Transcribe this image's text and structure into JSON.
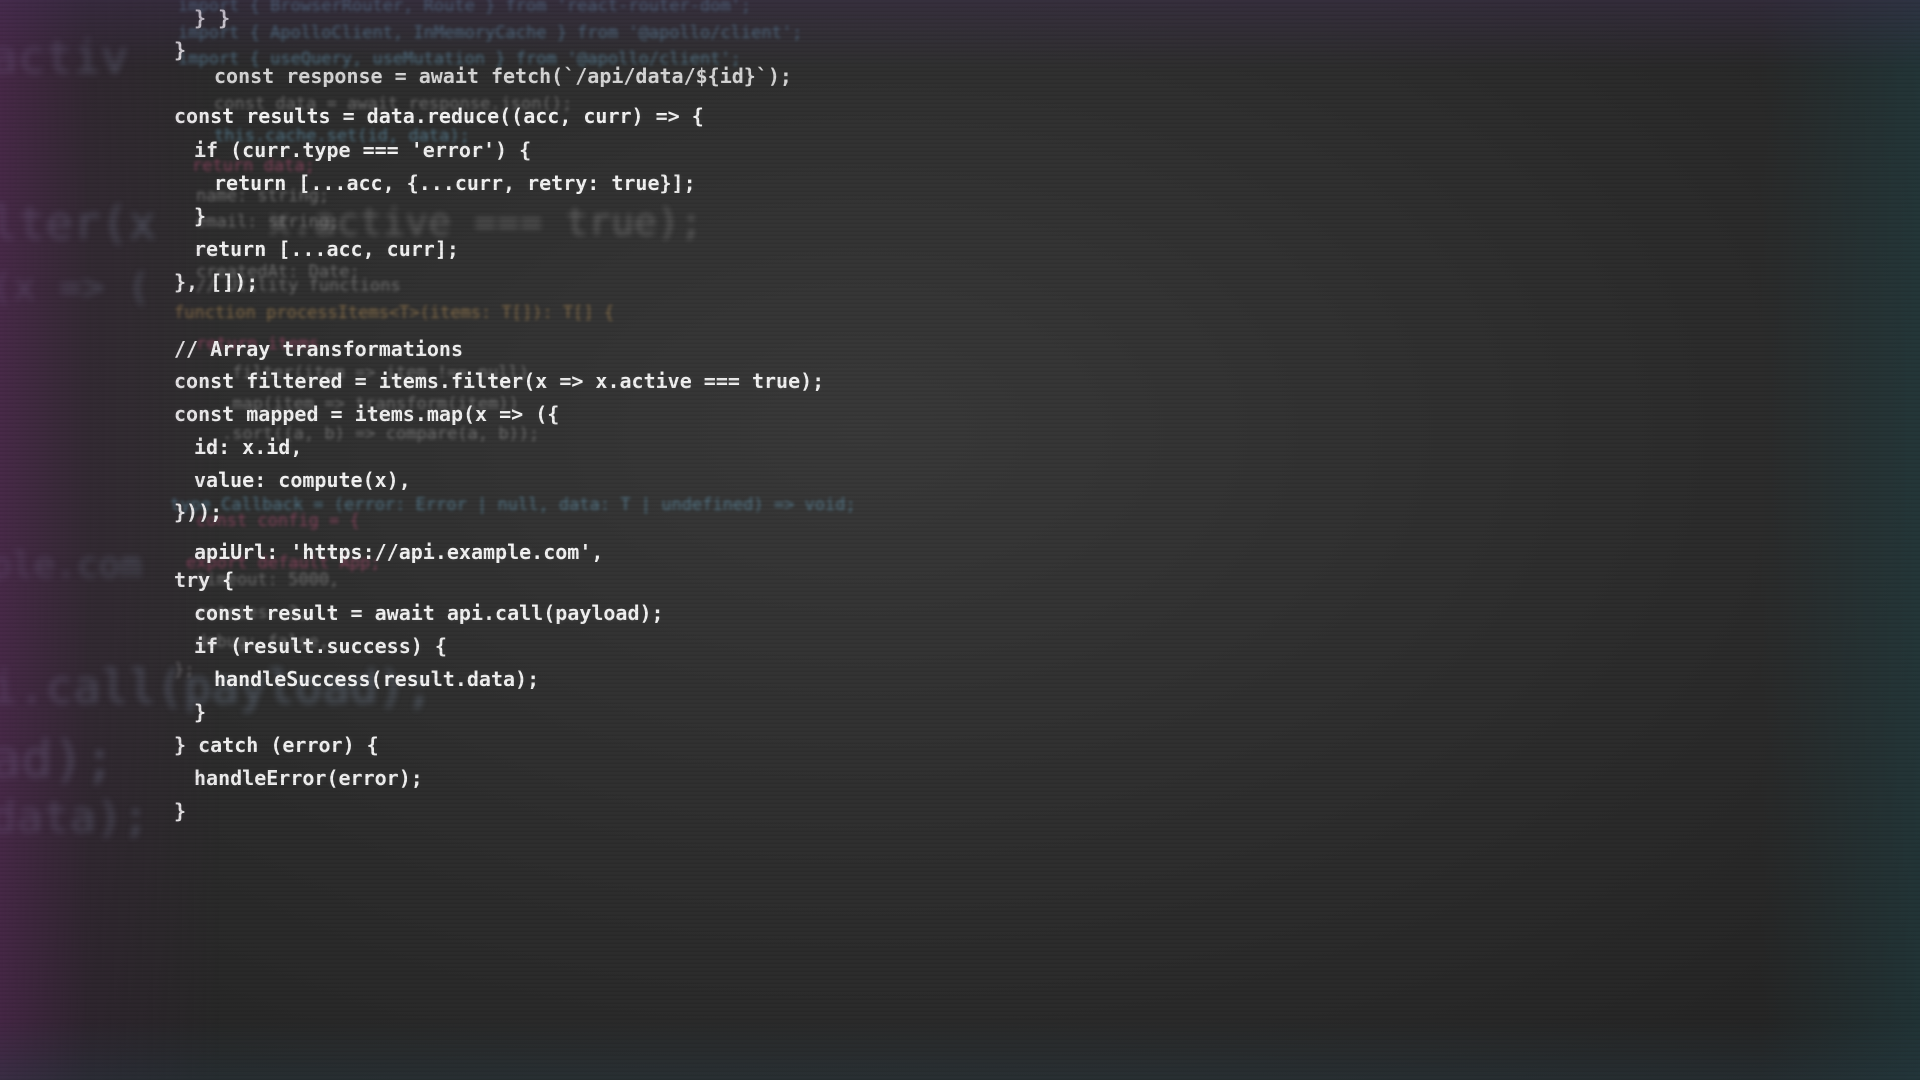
{
  "colors": {
    "keyword": "#ff3f7c",
    "function": "#ffb84a",
    "string": "#f4e36a",
    "boolean": "#ff9aaa",
    "variable": "#a6d8ff",
    "plain": "#f2f2f2",
    "comment": "#9a9a9a",
    "background": "#2f2f2f"
  },
  "far_background": [
    "activ",
    "lter(x",
    "(x => (",
    "ple.com",
    "i.call(payload);",
    "ad);",
    "data);"
  ],
  "ghost_large": [
    "x.active === true);"
  ],
  "ghost": [
    "import { BrowserRouter, Route } from 'react-router-dom';",
    "import { ApolloClient, InMemoryCache } from '@apollo/client';",
    "import { useQuery, useMutation } from '@apollo/client';",
    "const data = await response.json();",
    "this.cache.set(id, data);",
    "return data;",
    "name: string;",
    "email: string;",
    "createdAt: Date;",
    "// Utility functions",
    "function processItems<T>(items: T[]): T[] {",
    "return items",
    ".filter(item => item !== null)",
    ".map(item => transform(item))",
    ".sort((a, b) => compare(a, b));",
    "type Callback = (error: Error | null, data: T | undefined) => void;",
    "const config = {",
    "export default App;",
    "timeout: 5000,",
    "retries: 3,",
    "debug: false,",
    "};"
  ],
  "code": [
    "} }",
    "}",
    "const response = await fetch(`/api/data/${id}`);",
    "const results = data.reduce((acc, curr) => {",
    "if (curr.type === 'error') {",
    "return [...acc, {...curr, retry: true}];",
    "}",
    "return [...acc, curr];",
    "}, []);",
    "// Array transformations",
    "const filtered = items.filter(x => x.active === true);",
    "const mapped = items.map(x => ({",
    "id: x.id,",
    "value: compute(x),",
    "}));",
    "apiUrl: 'https://api.example.com',",
    "try {",
    "const result = await api.call(payload);",
    "if (result.success) {",
    "handleSuccess(result.data);",
    "}",
    "} catch (error) {",
    "handleError(error);",
    "}"
  ]
}
